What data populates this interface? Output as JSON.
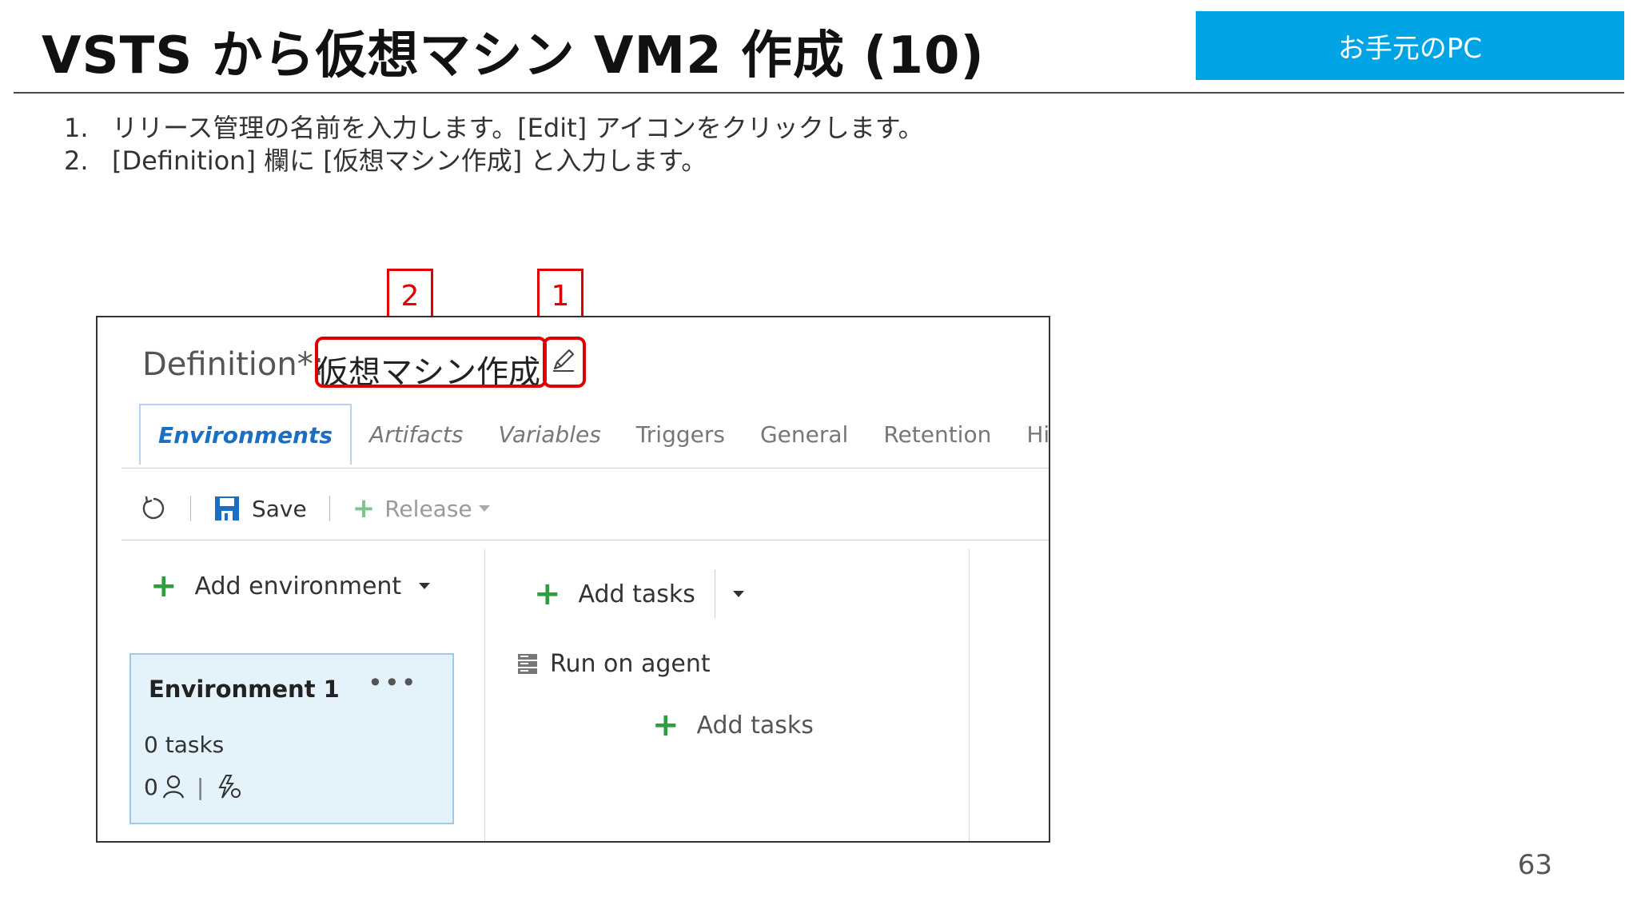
{
  "slide": {
    "title": "VSTS から仮想マシン VM2 作成 (10)",
    "badge": "お手元のPC",
    "page_number": "63",
    "steps": [
      {
        "num": "1.",
        "text": "リリース管理の名前を入力します。[Edit] アイコンをクリックします。"
      },
      {
        "num": "2.",
        "text": "[Definition] 欄に [仮想マシン作成] と入力します。"
      }
    ],
    "callouts": {
      "one": "1",
      "two": "2"
    }
  },
  "screenshot": {
    "definition_label": "Definition*:",
    "definition_value": "仮想マシン作成",
    "edit_icon": "pencil-icon",
    "tabs": [
      {
        "label": "Environments"
      },
      {
        "label": "Artifacts"
      },
      {
        "label": "Variables"
      },
      {
        "label": "Triggers"
      },
      {
        "label": "General"
      },
      {
        "label": "Retention"
      },
      {
        "label": "History"
      }
    ],
    "toolbar": {
      "save": "Save",
      "release": "Release"
    },
    "add_environment": "Add environment",
    "environment": {
      "name": "Environment 1",
      "tasks": "0 tasks",
      "approvers": "0"
    },
    "add_tasks": "Add tasks",
    "run_on_agent": "Run on agent",
    "add_tasks_inner": "Add tasks",
    "colors": {
      "accent": "#00a4e4",
      "highlight": "#e00000",
      "tab_active": "#1a6fc4",
      "plus": "#2f9e3f",
      "card": "#e4f2fa"
    }
  }
}
